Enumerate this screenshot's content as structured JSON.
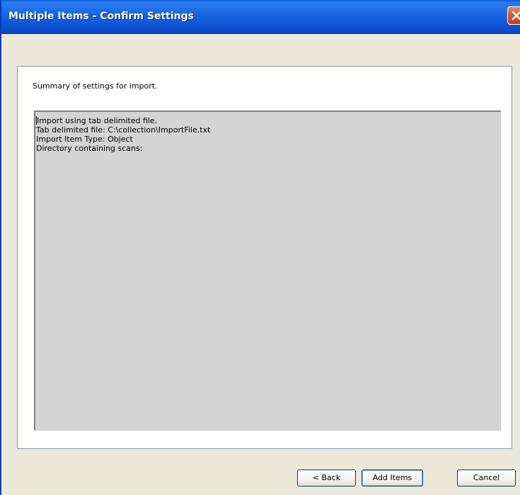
{
  "window": {
    "title": "Multiple Items - Confirm Settings"
  },
  "panel": {
    "summary_label": "Summary of settings for import.",
    "summary_lines": [
      "Import using tab delimited file.",
      "Tab delimited file: C:\\collection\\ImportFile.txt",
      "Import Item Type: Object",
      "Directory containing scans:"
    ]
  },
  "buttons": {
    "back": "< Back",
    "add_items": "Add Items",
    "cancel": "Cancel"
  },
  "icons": {
    "close": "close-icon"
  },
  "colors": {
    "titlebar": "#1a64e0",
    "close_button": "#d8542e",
    "window_bg": "#ece9d8",
    "summary_bg": "#d4d4d4"
  }
}
